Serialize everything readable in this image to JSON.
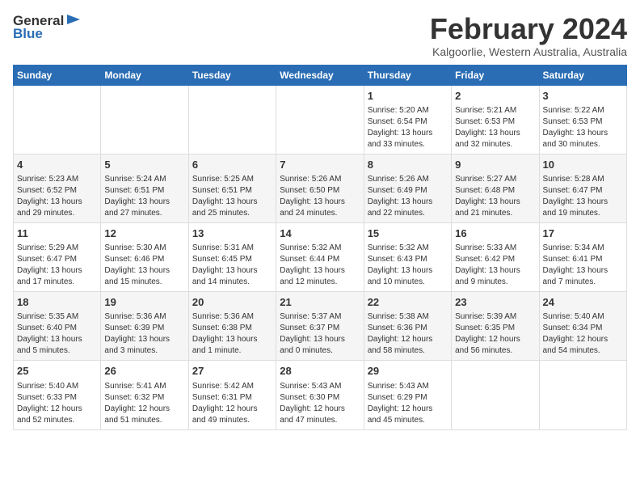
{
  "header": {
    "logo_line1": "General",
    "logo_line2": "Blue",
    "month_year": "February 2024",
    "location": "Kalgoorlie, Western Australia, Australia"
  },
  "columns": [
    "Sunday",
    "Monday",
    "Tuesday",
    "Wednesday",
    "Thursday",
    "Friday",
    "Saturday"
  ],
  "weeks": [
    [
      {
        "day": "",
        "empty": true
      },
      {
        "day": "",
        "empty": true
      },
      {
        "day": "",
        "empty": true
      },
      {
        "day": "",
        "empty": true
      },
      {
        "day": "1",
        "sunrise": "5:20 AM",
        "sunset": "6:54 PM",
        "daylight": "13 hours and 33 minutes."
      },
      {
        "day": "2",
        "sunrise": "5:21 AM",
        "sunset": "6:53 PM",
        "daylight": "13 hours and 32 minutes."
      },
      {
        "day": "3",
        "sunrise": "5:22 AM",
        "sunset": "6:53 PM",
        "daylight": "13 hours and 30 minutes."
      }
    ],
    [
      {
        "day": "4",
        "sunrise": "5:23 AM",
        "sunset": "6:52 PM",
        "daylight": "13 hours and 29 minutes."
      },
      {
        "day": "5",
        "sunrise": "5:24 AM",
        "sunset": "6:51 PM",
        "daylight": "13 hours and 27 minutes."
      },
      {
        "day": "6",
        "sunrise": "5:25 AM",
        "sunset": "6:51 PM",
        "daylight": "13 hours and 25 minutes."
      },
      {
        "day": "7",
        "sunrise": "5:26 AM",
        "sunset": "6:50 PM",
        "daylight": "13 hours and 24 minutes."
      },
      {
        "day": "8",
        "sunrise": "5:26 AM",
        "sunset": "6:49 PM",
        "daylight": "13 hours and 22 minutes."
      },
      {
        "day": "9",
        "sunrise": "5:27 AM",
        "sunset": "6:48 PM",
        "daylight": "13 hours and 21 minutes."
      },
      {
        "day": "10",
        "sunrise": "5:28 AM",
        "sunset": "6:47 PM",
        "daylight": "13 hours and 19 minutes."
      }
    ],
    [
      {
        "day": "11",
        "sunrise": "5:29 AM",
        "sunset": "6:47 PM",
        "daylight": "13 hours and 17 minutes."
      },
      {
        "day": "12",
        "sunrise": "5:30 AM",
        "sunset": "6:46 PM",
        "daylight": "13 hours and 15 minutes."
      },
      {
        "day": "13",
        "sunrise": "5:31 AM",
        "sunset": "6:45 PM",
        "daylight": "13 hours and 14 minutes."
      },
      {
        "day": "14",
        "sunrise": "5:32 AM",
        "sunset": "6:44 PM",
        "daylight": "13 hours and 12 minutes."
      },
      {
        "day": "15",
        "sunrise": "5:32 AM",
        "sunset": "6:43 PM",
        "daylight": "13 hours and 10 minutes."
      },
      {
        "day": "16",
        "sunrise": "5:33 AM",
        "sunset": "6:42 PM",
        "daylight": "13 hours and 9 minutes."
      },
      {
        "day": "17",
        "sunrise": "5:34 AM",
        "sunset": "6:41 PM",
        "daylight": "13 hours and 7 minutes."
      }
    ],
    [
      {
        "day": "18",
        "sunrise": "5:35 AM",
        "sunset": "6:40 PM",
        "daylight": "13 hours and 5 minutes."
      },
      {
        "day": "19",
        "sunrise": "5:36 AM",
        "sunset": "6:39 PM",
        "daylight": "13 hours and 3 minutes."
      },
      {
        "day": "20",
        "sunrise": "5:36 AM",
        "sunset": "6:38 PM",
        "daylight": "13 hours and 1 minute."
      },
      {
        "day": "21",
        "sunrise": "5:37 AM",
        "sunset": "6:37 PM",
        "daylight": "13 hours and 0 minutes."
      },
      {
        "day": "22",
        "sunrise": "5:38 AM",
        "sunset": "6:36 PM",
        "daylight": "12 hours and 58 minutes."
      },
      {
        "day": "23",
        "sunrise": "5:39 AM",
        "sunset": "6:35 PM",
        "daylight": "12 hours and 56 minutes."
      },
      {
        "day": "24",
        "sunrise": "5:40 AM",
        "sunset": "6:34 PM",
        "daylight": "12 hours and 54 minutes."
      }
    ],
    [
      {
        "day": "25",
        "sunrise": "5:40 AM",
        "sunset": "6:33 PM",
        "daylight": "12 hours and 52 minutes."
      },
      {
        "day": "26",
        "sunrise": "5:41 AM",
        "sunset": "6:32 PM",
        "daylight": "12 hours and 51 minutes."
      },
      {
        "day": "27",
        "sunrise": "5:42 AM",
        "sunset": "6:31 PM",
        "daylight": "12 hours and 49 minutes."
      },
      {
        "day": "28",
        "sunrise": "5:43 AM",
        "sunset": "6:30 PM",
        "daylight": "12 hours and 47 minutes."
      },
      {
        "day": "29",
        "sunrise": "5:43 AM",
        "sunset": "6:29 PM",
        "daylight": "12 hours and 45 minutes."
      },
      {
        "day": "",
        "empty": true
      },
      {
        "day": "",
        "empty": true
      }
    ]
  ]
}
